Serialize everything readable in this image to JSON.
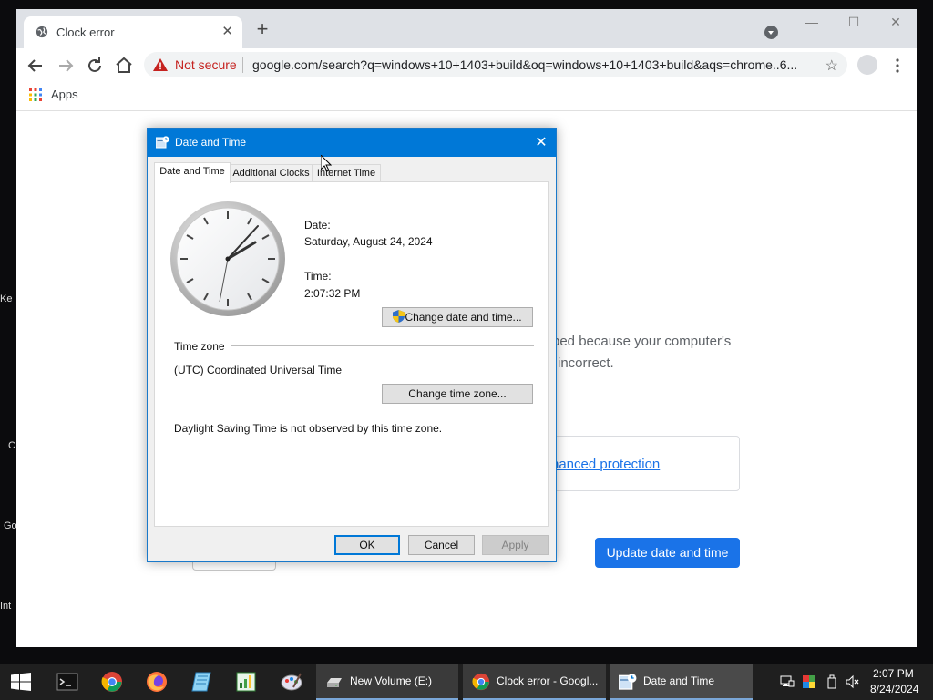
{
  "desktop": {
    "icon_labels": [
      "Ke",
      "C",
      "Go",
      "Int"
    ]
  },
  "browser": {
    "tab_title": "Clock error",
    "window_controls": {
      "minimize": "—",
      "maximize": "☐",
      "close": "✕"
    },
    "security_label": "Not secure",
    "url": "google.com/search?q=windows+10+1403+build&oq=windows+10+1403+build&aqs=chrome..6...",
    "bookmarks": {
      "apps_label": "Apps"
    },
    "page": {
      "body_line1": "ped because your computer's",
      "body_line2": "incorrect.",
      "advanced_link": "hanced protection",
      "update_button": "Update date and time"
    }
  },
  "dialog": {
    "title": "Date and Time",
    "tabs": [
      {
        "label": "Date and Time",
        "active": true
      },
      {
        "label": "Additional Clocks",
        "active": false
      },
      {
        "label": "Internet Time",
        "active": false
      }
    ],
    "date_label": "Date:",
    "date_value": "Saturday, August 24, 2024",
    "time_label": "Time:",
    "time_value": "2:07:32 PM",
    "change_datetime_button": "Change date and time...",
    "timezone_heading": "Time zone",
    "timezone_value": "(UTC) Coordinated Universal Time",
    "change_timezone_button": "Change time zone...",
    "dst_note": "Daylight Saving Time is not observed by this time zone.",
    "ok_button": "OK",
    "cancel_button": "Cancel",
    "apply_button": "Apply"
  },
  "taskbar": {
    "windows": [
      {
        "label": "New Volume (E:)",
        "icon": "drive-icon"
      },
      {
        "label": "Clock error - Googl...",
        "icon": "chrome-icon"
      },
      {
        "label": "Date and Time",
        "icon": "date-time-icon",
        "active": true
      }
    ],
    "clock_time": "2:07 PM",
    "clock_date": "8/24/2024"
  },
  "colors": {
    "accent_blue": "#1a73e8",
    "dialog_titlebar": "#0078d7",
    "not_secure_red": "#c5221f"
  }
}
